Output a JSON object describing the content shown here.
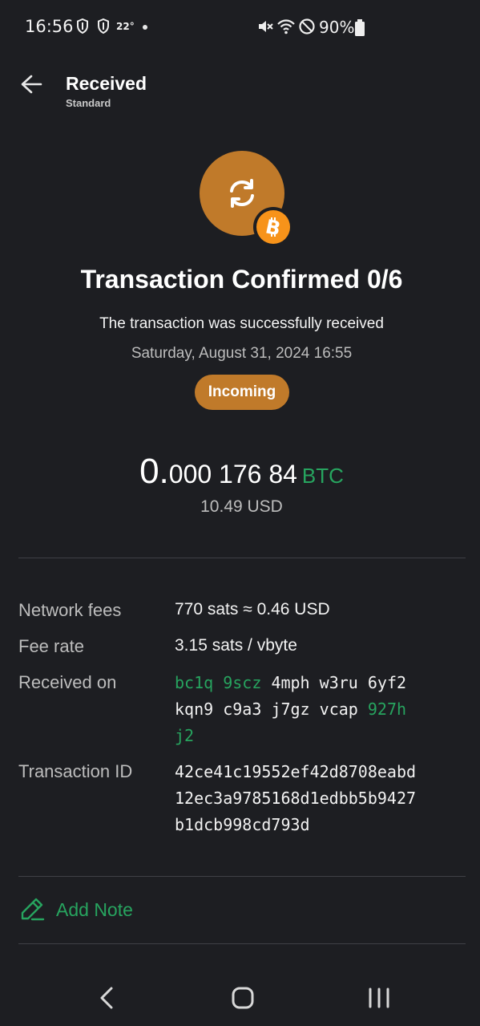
{
  "status_bar": {
    "time": "16:56",
    "temperature": "22°",
    "battery": "90%",
    "icons": [
      "shield-icon",
      "shield-icon",
      "mute-icon",
      "wifi-icon",
      "do-not-disturb-icon",
      "battery-icon"
    ]
  },
  "header": {
    "title": "Received",
    "subtitle": "Standard",
    "back_icon": "arrow-left-icon"
  },
  "hero": {
    "icon": "refresh-icon",
    "badge_icon": "bitcoin-icon",
    "accent_color": "#c07a2a",
    "badge_color": "#f7931a"
  },
  "status": {
    "title": "Transaction Confirmed 0/6",
    "description": "The transaction was successfully received",
    "date": "Saturday, August 31, 2024 16:55",
    "badge": "Incoming"
  },
  "amount": {
    "lead": "0.",
    "rest": "000 176 84",
    "unit": "BTC",
    "fiat": "10.49 USD",
    "unit_color": "#27a45f"
  },
  "details": {
    "fees_label": "Network fees",
    "fees_value": "770 sats ≈ 0.46 USD",
    "rate_label": "Fee rate",
    "rate_value": "3.15 sats / vbyte",
    "received_label": "Received on",
    "address_line1": [
      {
        "text": "bc1q",
        "green": true
      },
      {
        "text": "9scz",
        "green": true
      },
      {
        "text": "4mph",
        "green": false
      },
      {
        "text": "w3ru",
        "green": false
      },
      {
        "text": "6yf2",
        "green": false
      }
    ],
    "address_line2": [
      {
        "text": "kqn9",
        "green": false
      },
      {
        "text": "c9a3",
        "green": false
      },
      {
        "text": "j7gz",
        "green": false
      },
      {
        "text": "vcap",
        "green": false
      },
      {
        "text": "927h",
        "green": true
      }
    ],
    "address_line3": [
      {
        "text": "j2",
        "green": true
      }
    ],
    "txid_label": "Transaction ID",
    "txid_lines": [
      "42ce41c19552ef42d8708eabd",
      "12ec3a9785168d1edbb5b9427",
      "b1dcb998cd793d"
    ]
  },
  "note": {
    "label": "Add Note",
    "icon": "pencil-icon"
  },
  "navbar": {
    "icons": [
      "nav-back-icon",
      "nav-home-icon",
      "nav-recents-icon"
    ]
  }
}
